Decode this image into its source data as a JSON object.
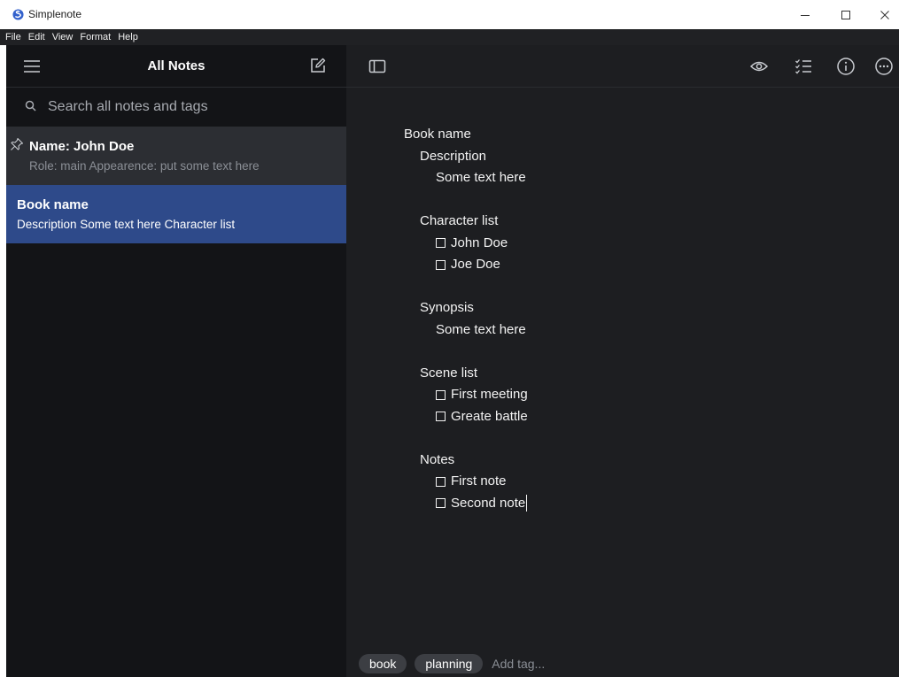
{
  "window": {
    "title": "Simplenote"
  },
  "menubar": {
    "items": [
      "File",
      "Edit",
      "View",
      "Format",
      "Help"
    ]
  },
  "sidebar": {
    "title": "All Notes",
    "search_placeholder": "Search all notes and tags",
    "notes": [
      {
        "title": "Name: John Doe",
        "preview": "Role: main Appearence: put some text here",
        "pinned": true,
        "selected": false
      },
      {
        "title": "Book name",
        "preview": "Description Some text here Character list",
        "pinned": false,
        "selected": true
      }
    ]
  },
  "editor": {
    "lines": [
      {
        "text": "Book name",
        "indent": 0,
        "checkbox": false
      },
      {
        "text": "Description",
        "indent": 1,
        "checkbox": false
      },
      {
        "text": "Some text here",
        "indent": 2,
        "checkbox": false
      },
      {
        "text": "",
        "indent": 0,
        "checkbox": false
      },
      {
        "text": "Character list",
        "indent": 1,
        "checkbox": false
      },
      {
        "text": "John Doe",
        "indent": 1,
        "checkbox": true
      },
      {
        "text": "Joe Doe",
        "indent": 1,
        "checkbox": true
      },
      {
        "text": "",
        "indent": 0,
        "checkbox": false
      },
      {
        "text": "Synopsis",
        "indent": 1,
        "checkbox": false
      },
      {
        "text": "Some text here",
        "indent": 2,
        "checkbox": false
      },
      {
        "text": "",
        "indent": 0,
        "checkbox": false
      },
      {
        "text": "Scene list",
        "indent": 1,
        "checkbox": false
      },
      {
        "text": "First meeting",
        "indent": 1,
        "checkbox": true
      },
      {
        "text": "Greate battle",
        "indent": 1,
        "checkbox": true
      },
      {
        "text": "",
        "indent": 0,
        "checkbox": false
      },
      {
        "text": "Notes",
        "indent": 1,
        "checkbox": false
      },
      {
        "text": "First note",
        "indent": 1,
        "checkbox": true
      },
      {
        "text": "Second note",
        "indent": 1,
        "checkbox": true,
        "caret": true
      }
    ],
    "tags": [
      "book",
      "planning"
    ],
    "add_tag_placeholder": "Add tag..."
  },
  "colors": {
    "sidebar_bg": "#131417",
    "editor_bg": "#1d1e21",
    "selected_note": "#2e4a8a",
    "pinned_note": "#2c2e33",
    "accent": "#3361cc"
  },
  "icons": [
    "simplenote-logo-icon",
    "minimize-icon",
    "maximize-icon",
    "close-icon",
    "menu-icon",
    "new-note-icon",
    "search-icon",
    "pin-icon",
    "sidebar-toggle-icon",
    "preview-icon",
    "checklist-icon",
    "info-icon",
    "more-icon"
  ]
}
